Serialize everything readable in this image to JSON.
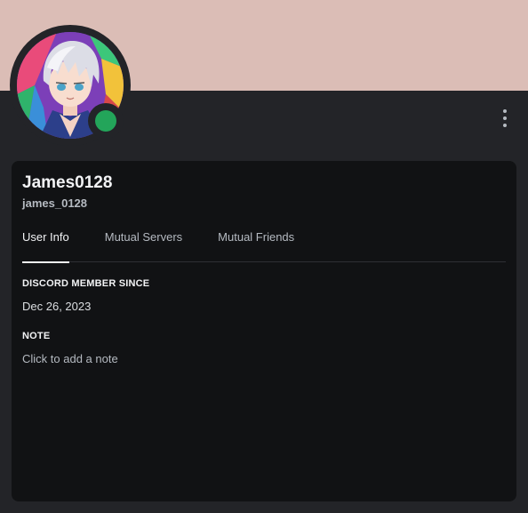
{
  "profile": {
    "display_name": "James0128",
    "username": "james_0128",
    "status_color": "#23a55a",
    "banner_color": "#dbbdb6"
  },
  "tabs": [
    {
      "label": "User Info"
    },
    {
      "label": "Mutual Servers"
    },
    {
      "label": "Mutual Friends"
    }
  ],
  "active_tab": "User Info",
  "member_since": {
    "title": "Discord Member Since",
    "value": "Dec 26, 2023"
  },
  "note": {
    "title": "Note",
    "placeholder": "Click to add a note"
  },
  "icons": {
    "more": "kebab-vertical-icon"
  }
}
